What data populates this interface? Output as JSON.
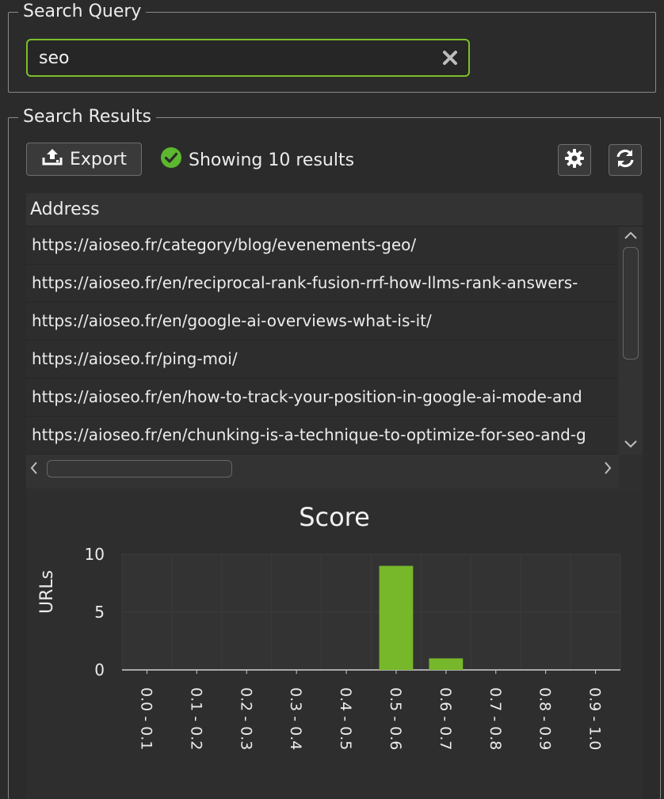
{
  "search_query": {
    "title": "Search Query",
    "value": "seo"
  },
  "search_results": {
    "title": "Search Results",
    "export_label": "Export",
    "status_text": "Showing 10 results",
    "table": {
      "column_header": "Address",
      "rows": [
        "https://aioseo.fr/category/blog/evenements-geo/",
        "https://aioseo.fr/en/reciprocal-rank-fusion-rrf-how-llms-rank-answers-",
        "https://aioseo.fr/en/google-ai-overviews-what-is-it/",
        "https://aioseo.fr/ping-moi/",
        "https://aioseo.fr/en/how-to-track-your-position-in-google-ai-mode-and",
        "https://aioseo.fr/en/chunking-is-a-technique-to-optimize-for-seo-and-g"
      ]
    }
  },
  "colors": {
    "accent": "#7bbf2a",
    "bar": "#77b72a",
    "status_ok": "#5cb82e"
  },
  "icons": {
    "clear": "close-x-icon",
    "export": "upload-icon",
    "status": "check-circle-icon",
    "settings": "gear-icon",
    "refresh": "refresh-icon"
  },
  "chart_data": {
    "type": "bar",
    "title": "Score",
    "xlabel": "",
    "ylabel": "URLs",
    "categories": [
      "0.0 - 0.1",
      "0.1 - 0.2",
      "0.2 - 0.3",
      "0.3 - 0.4",
      "0.4 - 0.5",
      "0.5 - 0.6",
      "0.6 - 0.7",
      "0.7 - 0.8",
      "0.8 - 0.9",
      "0.9 - 1.0"
    ],
    "values": [
      0,
      0,
      0,
      0,
      0,
      9,
      1,
      0,
      0,
      0
    ],
    "ylim": [
      0,
      10
    ],
    "yticks": [
      "0",
      "5",
      "10"
    ],
    "grid": true,
    "legend": "none"
  }
}
